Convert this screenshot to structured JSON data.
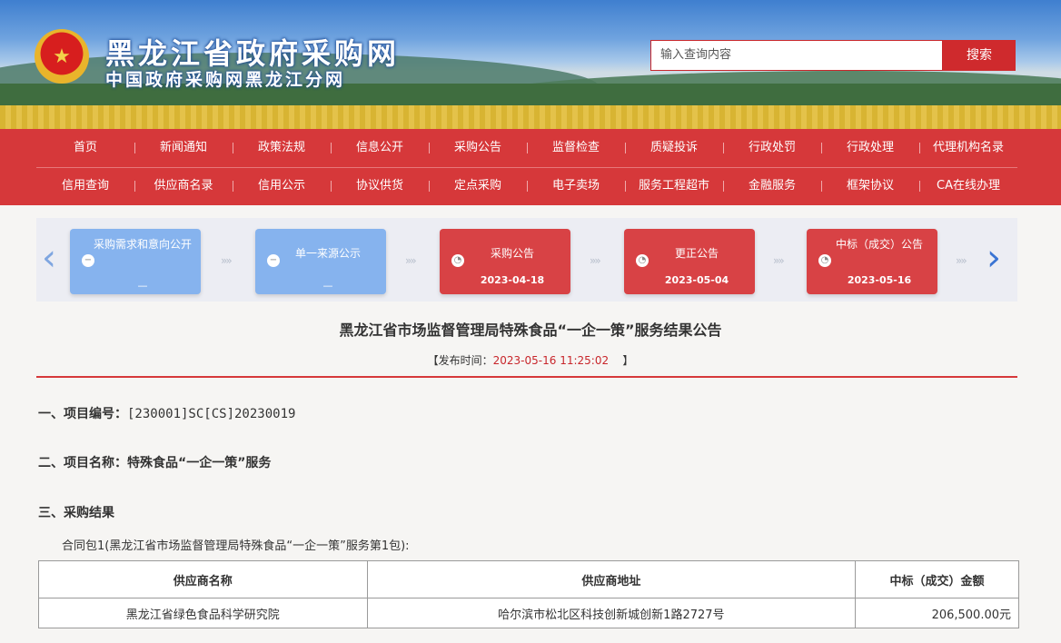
{
  "header": {
    "site_title": "黑龙江省政府采购网",
    "site_subtitle": "中国政府采购网黑龙江分网",
    "search_placeholder": "输入查询内容",
    "search_button": "搜索"
  },
  "nav": {
    "row1": [
      "首页",
      "新闻通知",
      "政策法规",
      "信息公开",
      "采购公告",
      "监督检查",
      "质疑投诉",
      "行政处罚",
      "行政处理",
      "代理机构名录"
    ],
    "row2": [
      "信用查询",
      "供应商名录",
      "信用公示",
      "协议供货",
      "定点采购",
      "电子卖场",
      "服务工程超市",
      "金融服务",
      "框架协议",
      "CA在线办理"
    ]
  },
  "progress": {
    "steps": [
      {
        "label": "采购需求和意向公开",
        "date": "—",
        "state": "inactive"
      },
      {
        "label": "单一来源公示",
        "date": "—",
        "state": "inactive"
      },
      {
        "label": "采购公告",
        "date": "2023-04-18",
        "state": "active"
      },
      {
        "label": "更正公告",
        "date": "2023-05-04",
        "state": "active"
      },
      {
        "label": "中标（成交）公告",
        "date": "2023-05-16",
        "state": "active"
      }
    ],
    "colors": {
      "inactive": "#86b3ee",
      "active": "#d84245"
    }
  },
  "article": {
    "title": "黑龙江省市场监督管理局特殊食品“一企一策”服务结果公告",
    "pub_label": "【发布时间：",
    "pub_time": "2023-05-16 11:25:02",
    "pub_end": "】",
    "sections": [
      {
        "label": "一、项目编号：",
        "value": "[230001]SC[CS]20230019"
      },
      {
        "label": "二、项目名称：",
        "value": "特殊食品“一企一策”服务"
      },
      {
        "label": "三、采购结果",
        "value": ""
      }
    ],
    "package_line": "合同包1(黑龙江省市场监督管理局特殊食品“一企一策”服务第1包):",
    "table": {
      "headers": [
        "供应商名称",
        "供应商地址",
        "中标（成交）金额"
      ],
      "rows": [
        [
          "黑龙江省绿色食品科学研究院",
          "哈尔滨市松北区科技创新城创新1路2727号",
          "206,500.00元"
        ]
      ]
    }
  },
  "accent_color": "#d6383a"
}
